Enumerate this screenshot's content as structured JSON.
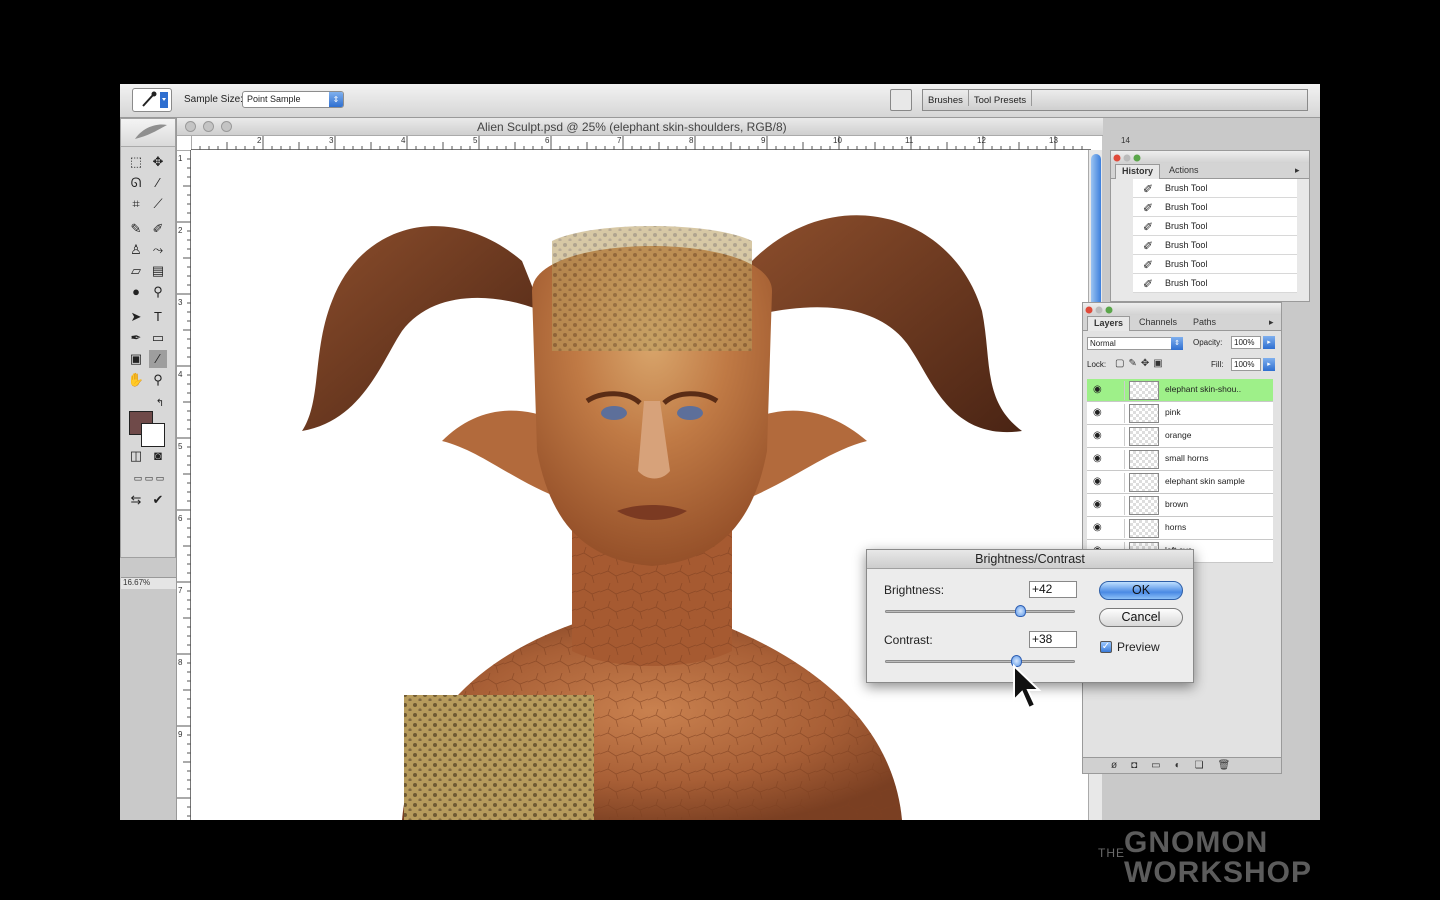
{
  "options_bar": {
    "sample_size_label": "Sample Size:",
    "sample_size_value": "Point Sample",
    "palette_tabs": [
      "Brushes",
      "Tool Presets"
    ]
  },
  "toolbox": {
    "zoom_readout": "16.67%",
    "foreground_color": "#6f4a49",
    "background_color": "#ffffff"
  },
  "document": {
    "title": "Alien Sculpt.psd @ 25% (elephant skin-shoulders, RGB/8)",
    "ruler_numbers": [
      "2",
      "3",
      "4",
      "5",
      "6",
      "7",
      "8",
      "9",
      "10",
      "11",
      "12",
      "13",
      "14"
    ],
    "ruler_left_numbers": [
      "1",
      "2",
      "3",
      "4",
      "5",
      "6",
      "7",
      "8",
      "9"
    ]
  },
  "history": {
    "tabs": [
      "History",
      "Actions"
    ],
    "items": [
      "Brush Tool",
      "Brush Tool",
      "Brush Tool",
      "Brush Tool",
      "Brush Tool",
      "Brush Tool"
    ]
  },
  "layers": {
    "tabs": [
      "Layers",
      "Channels",
      "Paths"
    ],
    "blend_mode": "Normal",
    "opacity_label": "Opacity:",
    "opacity_value": "100%",
    "lock_label": "Lock:",
    "fill_label": "Fill:",
    "fill_value": "100%",
    "items": [
      "elephant skin-shou..",
      "pink",
      "orange",
      "small horns",
      "elephant skin sample",
      "brown",
      "horns",
      "left eye"
    ],
    "selected_color": "#9ef089"
  },
  "dialog": {
    "title": "Brightness/Contrast",
    "brightness_label": "Brightness:",
    "brightness_value": "+42",
    "brightness_level": 42,
    "contrast_label": "Contrast:",
    "contrast_value": "+38",
    "contrast_level": 38,
    "ok_label": "OK",
    "cancel_label": "Cancel",
    "preview_label": "Preview",
    "preview_checked": true
  },
  "watermark": {
    "prefix": "THE",
    "line1": "GNOMON",
    "line2": "WORKSHOP"
  }
}
